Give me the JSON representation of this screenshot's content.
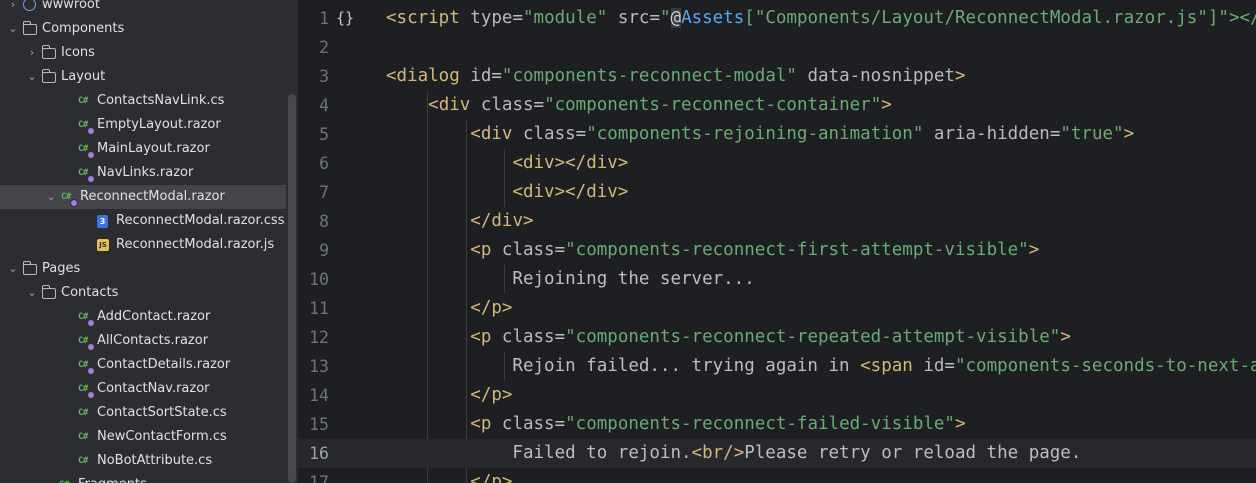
{
  "tree": {
    "rows": [
      {
        "label": "wwwroot",
        "icon": "globe-icon",
        "chevron": "›",
        "chevron_name": "chevron-right-icon"
      },
      {
        "label": "Components",
        "icon": "folder-icon",
        "chevron": "⌄",
        "chevron_name": "chevron-down-icon"
      },
      {
        "label": "Icons",
        "icon": "folder-icon",
        "chevron": "›",
        "chevron_name": "chevron-right-icon"
      },
      {
        "label": "Layout",
        "icon": "folder-icon",
        "chevron": "⌄",
        "chevron_name": "chevron-down-icon"
      },
      {
        "label": "ContactsNavLink.cs",
        "icon": "csharp-icon"
      },
      {
        "label": "EmptyLayout.razor",
        "icon": "razor-icon"
      },
      {
        "label": "MainLayout.razor",
        "icon": "razor-icon"
      },
      {
        "label": "NavLinks.razor",
        "icon": "razor-icon"
      },
      {
        "label": "ReconnectModal.razor",
        "icon": "razor-icon",
        "chevron": "⌄",
        "chevron_name": "chevron-down-icon",
        "selected": true
      },
      {
        "label": "ReconnectModal.razor.css",
        "icon": "css-file-icon"
      },
      {
        "label": "ReconnectModal.razor.js",
        "icon": "js-file-icon"
      },
      {
        "label": "Pages",
        "icon": "folder-icon",
        "chevron": "⌄",
        "chevron_name": "chevron-down-icon"
      },
      {
        "label": "Contacts",
        "icon": "folder-icon",
        "chevron": "⌄",
        "chevron_name": "chevron-down-icon"
      },
      {
        "label": "AddContact.razor",
        "icon": "razor-icon"
      },
      {
        "label": "AllContacts.razor",
        "icon": "razor-icon"
      },
      {
        "label": "ContactDetails.razor",
        "icon": "razor-icon"
      },
      {
        "label": "ContactNav.razor",
        "icon": "razor-icon"
      },
      {
        "label": "ContactSortState.cs",
        "icon": "csharp-icon"
      },
      {
        "label": "NewContactForm.cs",
        "icon": "csharp-icon"
      },
      {
        "label": "NoBotAttribute.cs",
        "icon": "csharp-icon"
      },
      {
        "label": "Fragments",
        "icon": "csharp-icon"
      }
    ],
    "icon_glyphs": {
      "csharp": "C#",
      "css": "3",
      "js": "JS"
    }
  },
  "editor": {
    "fold_marker": "{}",
    "lines": [
      {
        "num": "1",
        "tokens": [
          [
            "tag",
            "<script "
          ],
          [
            "attr",
            "type"
          ],
          [
            "eq",
            "="
          ],
          [
            "str",
            "\"module\" "
          ],
          [
            "attr",
            "src"
          ],
          [
            "eq",
            "="
          ],
          [
            "str",
            "\""
          ],
          [
            "at",
            "@"
          ],
          [
            "razor",
            "Assets"
          ],
          [
            "str",
            "[\"Components/Layout/ReconnectModal.razor.js\"]\"></"
          ],
          [
            "tag",
            "script>"
          ]
        ]
      },
      {
        "num": "2",
        "tokens": []
      },
      {
        "num": "3",
        "tokens": [
          [
            "tag",
            "<dialog "
          ],
          [
            "attr",
            "id"
          ],
          [
            "eq",
            "="
          ],
          [
            "str",
            "\"components-reconnect-modal\" "
          ],
          [
            "attr",
            "data-nosnippet"
          ],
          [
            "tag",
            ">"
          ]
        ]
      },
      {
        "num": "4",
        "tokens": [
          [
            "txt",
            "    "
          ],
          [
            "tag",
            "<div "
          ],
          [
            "attr",
            "class"
          ],
          [
            "eq",
            "="
          ],
          [
            "str",
            "\"components-reconnect-container\""
          ],
          [
            "tag",
            ">"
          ]
        ]
      },
      {
        "num": "5",
        "tokens": [
          [
            "txt",
            "        "
          ],
          [
            "tag",
            "<div "
          ],
          [
            "attr",
            "class"
          ],
          [
            "eq",
            "="
          ],
          [
            "str",
            "\"components-rejoining-animation\" "
          ],
          [
            "attr",
            "aria-hidden"
          ],
          [
            "eq",
            "="
          ],
          [
            "str",
            "\"true\""
          ],
          [
            "tag",
            ">"
          ]
        ]
      },
      {
        "num": "6",
        "tokens": [
          [
            "txt",
            "            "
          ],
          [
            "tag",
            "<div></div>"
          ]
        ]
      },
      {
        "num": "7",
        "tokens": [
          [
            "txt",
            "            "
          ],
          [
            "tag",
            "<div></div>"
          ]
        ]
      },
      {
        "num": "8",
        "tokens": [
          [
            "txt",
            "        "
          ],
          [
            "tag",
            "</div>"
          ]
        ]
      },
      {
        "num": "9",
        "tokens": [
          [
            "txt",
            "        "
          ],
          [
            "tag",
            "<p "
          ],
          [
            "attr",
            "class"
          ],
          [
            "eq",
            "="
          ],
          [
            "str",
            "\"components-reconnect-first-attempt-visible\""
          ],
          [
            "tag",
            ">"
          ]
        ]
      },
      {
        "num": "10",
        "tokens": [
          [
            "txt",
            "            Rejoining the server..."
          ]
        ]
      },
      {
        "num": "11",
        "tokens": [
          [
            "txt",
            "        "
          ],
          [
            "tag",
            "</p>"
          ]
        ]
      },
      {
        "num": "12",
        "tokens": [
          [
            "txt",
            "        "
          ],
          [
            "tag",
            "<p "
          ],
          [
            "attr",
            "class"
          ],
          [
            "eq",
            "="
          ],
          [
            "str",
            "\"components-reconnect-repeated-attempt-visible\""
          ],
          [
            "tag",
            ">"
          ]
        ]
      },
      {
        "num": "13",
        "tokens": [
          [
            "txt",
            "            Rejoin failed... trying again in "
          ],
          [
            "tag",
            "<span "
          ],
          [
            "attr",
            "id"
          ],
          [
            "eq",
            "="
          ],
          [
            "str",
            "\"components-seconds-to-next-attempt\""
          ]
        ]
      },
      {
        "num": "14",
        "tokens": [
          [
            "txt",
            "        "
          ],
          [
            "tag",
            "</p>"
          ]
        ]
      },
      {
        "num": "15",
        "tokens": [
          [
            "txt",
            "        "
          ],
          [
            "tag",
            "<p "
          ],
          [
            "attr",
            "class"
          ],
          [
            "eq",
            "="
          ],
          [
            "str",
            "\"components-reconnect-failed-visible\""
          ],
          [
            "tag",
            ">"
          ]
        ]
      },
      {
        "num": "16",
        "tokens": [
          [
            "txt",
            "            Failed to rejoin."
          ],
          [
            "tag",
            "<br/>"
          ],
          [
            "txt",
            "Please retry or reload the page."
          ]
        ],
        "current": true
      },
      {
        "num": "17",
        "tokens": [
          [
            "txt",
            "        "
          ],
          [
            "tag",
            "</p>"
          ]
        ]
      }
    ]
  }
}
